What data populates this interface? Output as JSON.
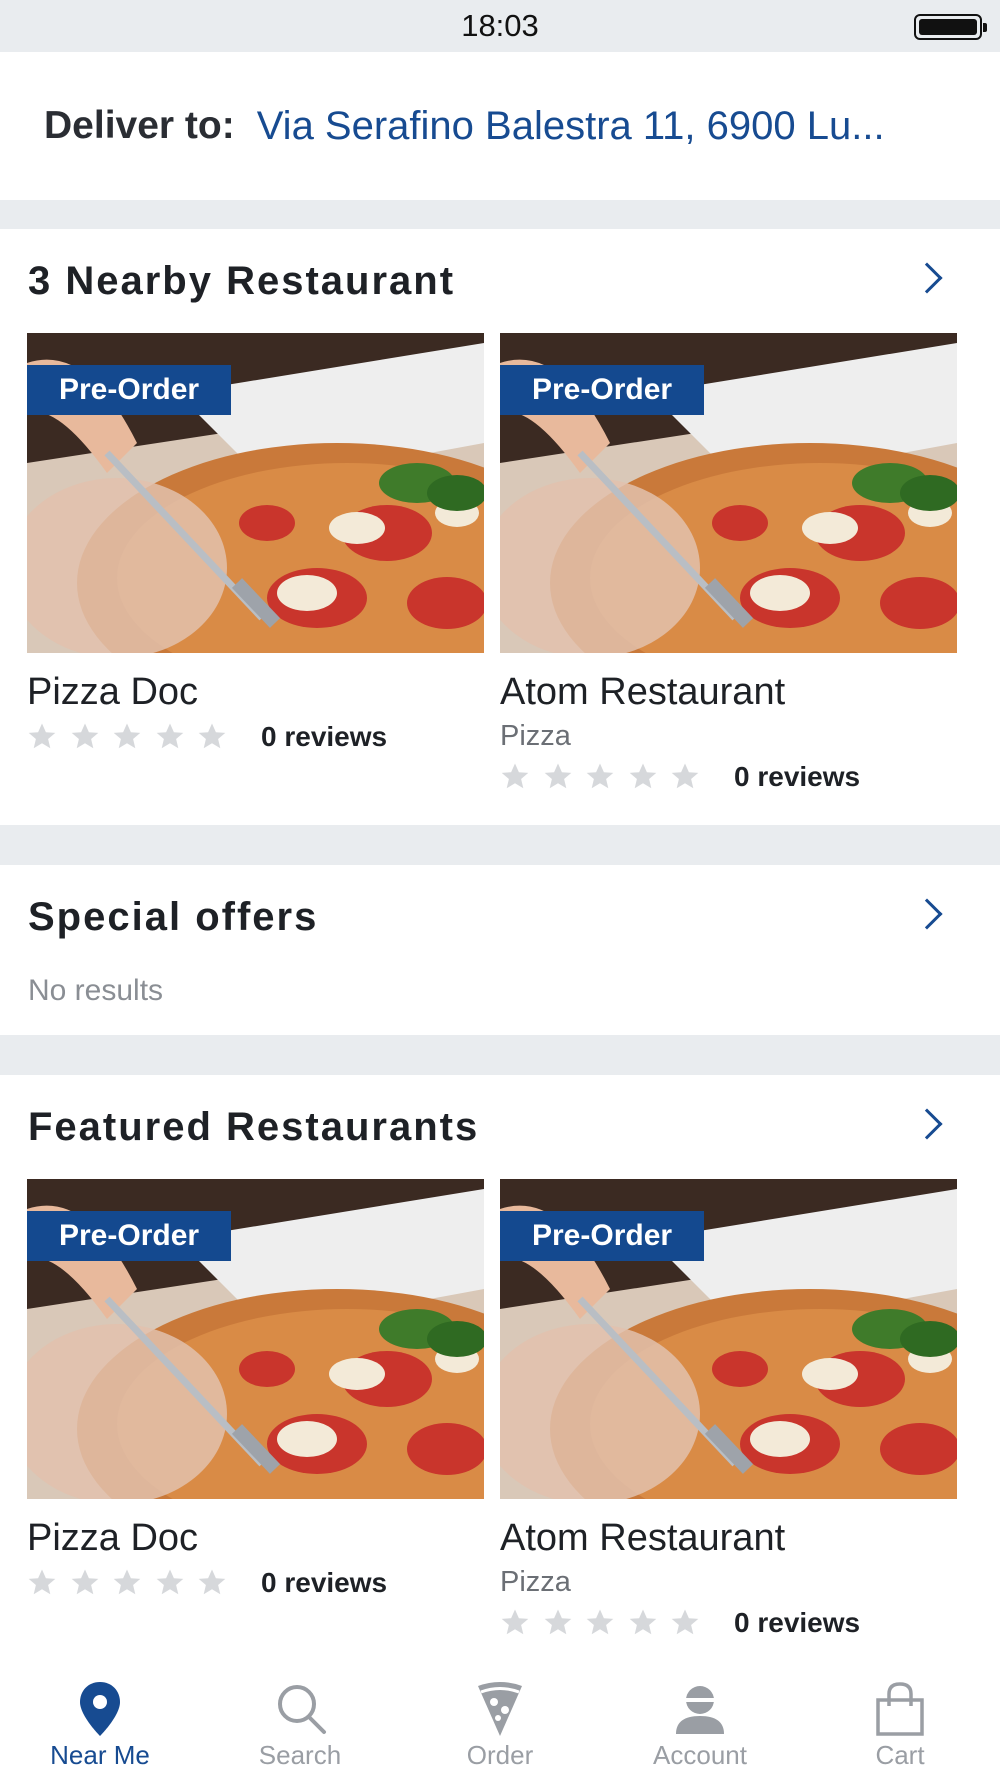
{
  "status_bar": {
    "time": "18:03",
    "battery_icon": "battery-full-icon"
  },
  "header": {
    "deliver_label": "Deliver to:",
    "address": "Via Serafino Balestra 11, 6900 Lu..."
  },
  "nearby": {
    "title": "3 Nearby Restaurant",
    "restaurants": [
      {
        "badge": "Pre-Order",
        "name": "Pizza Doc",
        "category": "",
        "rating": 0,
        "reviews": "0 reviews"
      },
      {
        "badge": "Pre-Order",
        "name": "Atom Restaurant",
        "category": "Pizza",
        "rating": 0,
        "reviews": "0 reviews"
      }
    ]
  },
  "special_offers": {
    "title": "Special offers",
    "empty_text": "No results"
  },
  "featured": {
    "title": "Featured Restaurants",
    "restaurants": [
      {
        "badge": "Pre-Order",
        "name": "Pizza Doc",
        "category": "",
        "rating": 0,
        "reviews": "0 reviews"
      },
      {
        "badge": "Pre-Order",
        "name": "Atom Restaurant",
        "category": "Pizza",
        "rating": 0,
        "reviews": "0 reviews"
      }
    ]
  },
  "tabbar": {
    "items": [
      {
        "label": "Near Me",
        "icon": "location-pin-icon",
        "active": true
      },
      {
        "label": "Search",
        "icon": "search-icon",
        "active": false
      },
      {
        "label": "Order",
        "icon": "pizza-slice-icon",
        "active": false
      },
      {
        "label": "Account",
        "icon": "user-icon",
        "active": false
      },
      {
        "label": "Cart",
        "icon": "shopping-bag-icon",
        "active": false
      }
    ]
  },
  "colors": {
    "accent": "#174b91",
    "badge": "#14498f",
    "inactive": "#9a9ea4",
    "background": "#e9ecef"
  }
}
